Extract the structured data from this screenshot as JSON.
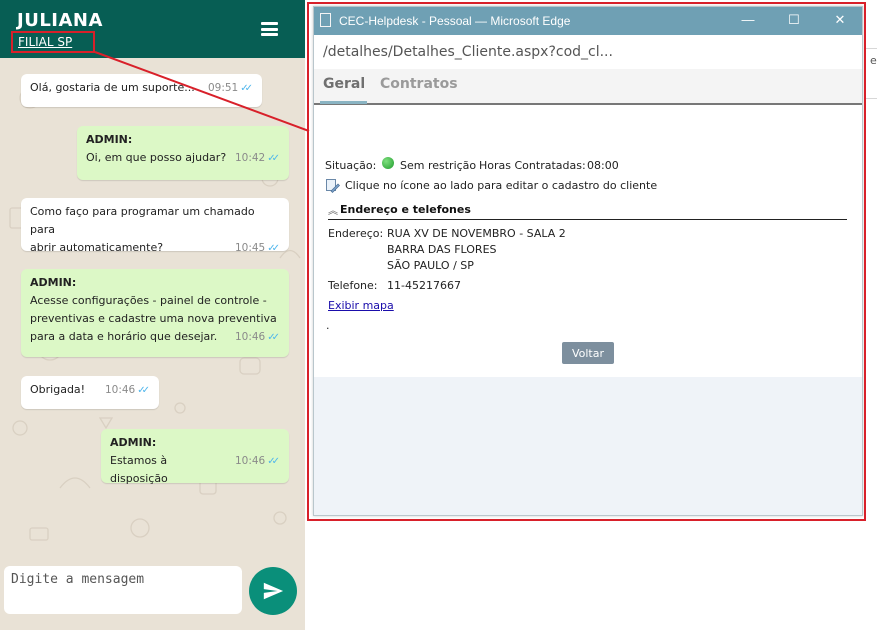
{
  "chat": {
    "contact_name": "JULIANA",
    "contact_subtitle": "FILIAL SP",
    "composer_placeholder": "Digite a mensagem",
    "colors": {
      "header": "#075e54",
      "incoming": "#ffffff",
      "outgoing": "#dcf8c6",
      "send": "#0a8f7a",
      "tick": "#4fb6ec"
    },
    "messages": [
      {
        "direction": "in",
        "author": "",
        "text": "Olá, gostaria de um suporte...",
        "time": "09:51",
        "read": true
      },
      {
        "direction": "out",
        "author": "ADMIN:",
        "text": "Oi, em que posso ajudar?",
        "time": "10:42",
        "read": true
      },
      {
        "direction": "in",
        "author": "",
        "text_lines": [
          "Como faço para programar um chamado para",
          "abrir automaticamente?"
        ],
        "time": "10:45",
        "read": true
      },
      {
        "direction": "out",
        "author": "ADMIN:",
        "text_lines": [
          "Acesse configurações - painel de controle -",
          "preventivas e cadastre uma nova preventiva",
          "para a data e horário que desejar."
        ],
        "time": "10:46",
        "read": true
      },
      {
        "direction": "in",
        "author": "",
        "text": "Obrigada!",
        "time": "10:46",
        "read": true
      },
      {
        "direction": "out",
        "author": "ADMIN:",
        "text": "Estamos à disposição",
        "time": "10:46",
        "read": true
      }
    ],
    "icons": {
      "menu": "hamburger-menu-icon",
      "send": "send-arrow-icon",
      "read": "double-check-icon"
    }
  },
  "browser": {
    "title": "CEC-Helpdesk - Pessoal — Microsoft Edge",
    "url": "/detalhes/Detalhes_Cliente.aspx?cod_cl...",
    "titlebar_color": "#6fa0b4",
    "controls": {
      "minimize": "—",
      "maximize": "☐",
      "close": "✕"
    },
    "tabs": [
      {
        "label": "Geral",
        "active": true
      },
      {
        "label": "Contratos",
        "active": false
      }
    ]
  },
  "client": {
    "situacao_label": "Situação:",
    "situacao_value": "Sem restrição",
    "horas_label": "Horas Contratadas:",
    "horas_value": "08:00",
    "edit_hint": "Clique no ícone ao lado para editar o cadastro do cliente",
    "section_title": "Endereço e telefones",
    "endereco_label": "Endereço:",
    "endereco_lines": [
      "RUA XV DE NOVEMBRO - SALA 2",
      "BARRA DAS FLORES",
      "SÃO PAULO / SP"
    ],
    "telefone_label": "Telefone:",
    "telefone_value": "11-45217667",
    "map_link": "Exibir mapa",
    "dot": ".",
    "back_button": "Voltar",
    "status_color": "#1f9b2c"
  },
  "background_page": {
    "letter": "e"
  },
  "annotation_color": "#d8202a"
}
